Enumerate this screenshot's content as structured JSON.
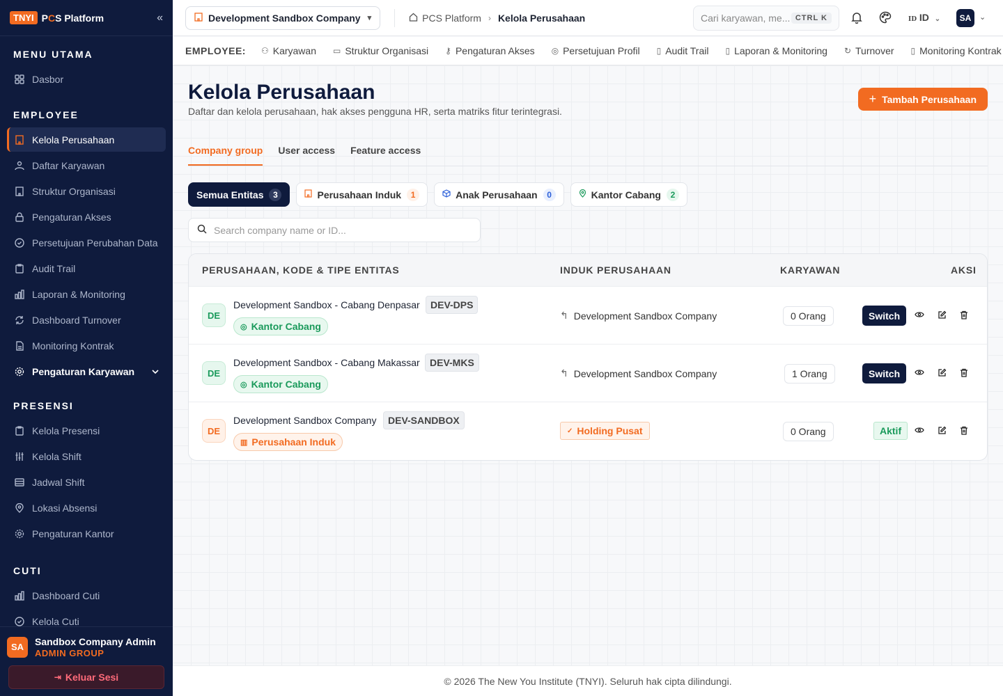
{
  "brand": {
    "badge": "TNYI",
    "name_prefix": "P",
    "name_accent": "C",
    "name_suffix": "S Platform"
  },
  "sidebar": {
    "sections": [
      {
        "title": "MENU UTAMA",
        "items": [
          {
            "label": "Dasbor",
            "icon": "grid-icon"
          }
        ]
      },
      {
        "title": "EMPLOYEE",
        "items": [
          {
            "label": "Kelola Perusahaan",
            "icon": "building-icon",
            "active": true
          },
          {
            "label": "Daftar Karyawan",
            "icon": "users-icon"
          },
          {
            "label": "Struktur Organisasi",
            "icon": "building-icon"
          },
          {
            "label": "Pengaturan Akses",
            "icon": "lock-icon"
          },
          {
            "label": "Persetujuan Perubahan Data",
            "icon": "check-circle-icon"
          },
          {
            "label": "Audit Trail",
            "icon": "clipboard-icon"
          },
          {
            "label": "Laporan & Monitoring",
            "icon": "chart-icon"
          },
          {
            "label": "Dashboard Turnover",
            "icon": "refresh-icon"
          },
          {
            "label": "Monitoring Kontrak",
            "icon": "file-icon"
          },
          {
            "label": "Pengaturan Karyawan",
            "icon": "gear-icon"
          }
        ]
      },
      {
        "title": "PRESENSI",
        "items": [
          {
            "label": "Kelola Presensi",
            "icon": "clipboard-icon"
          },
          {
            "label": "Kelola Shift",
            "icon": "sliders-icon"
          },
          {
            "label": "Jadwal Shift",
            "icon": "table-icon"
          },
          {
            "label": "Lokasi Absensi",
            "icon": "pin-icon"
          },
          {
            "label": "Pengaturan Kantor",
            "icon": "gear-icon"
          }
        ]
      },
      {
        "title": "CUTI",
        "items": [
          {
            "label": "Dashboard Cuti",
            "icon": "chart-icon"
          },
          {
            "label": "Kelola Cuti",
            "icon": "check-circle-icon"
          }
        ]
      }
    ],
    "user": {
      "initials": "SA",
      "name": "Sandbox Company Admin",
      "role": "ADMIN GROUP"
    },
    "logout": "Keluar Sesi"
  },
  "topbar": {
    "company": "Development Sandbox Company",
    "breadcrumb": [
      "PCS Platform",
      "Kelola Perusahaan"
    ],
    "search_placeholder": "Cari karyawan, me...",
    "shortcut": "CTRL K",
    "lang_small": "ID",
    "lang": "ID",
    "avatar": "SA"
  },
  "subnav": {
    "label": "EMPLOYEE:",
    "items": [
      "Karyawan",
      "Struktur Organisasi",
      "Pengaturan Akses",
      "Persetujuan Profil",
      "Audit Trail",
      "Laporan & Monitoring",
      "Turnover",
      "Monitoring Kontrak"
    ]
  },
  "page": {
    "title": "Kelola Perusahaan",
    "subtitle": "Daftar dan kelola perusahaan, hak akses pengguna HR, serta matriks fitur terintegrasi.",
    "add_button": "Tambah Perusahaan",
    "tabs": [
      "Company group",
      "User access",
      "Feature access"
    ],
    "filters": [
      {
        "label": "Semua Entitas",
        "count": "3"
      },
      {
        "label": "Perusahaan Induk",
        "count": "1"
      },
      {
        "label": "Anak Perusahaan",
        "count": "0"
      },
      {
        "label": "Kantor Cabang",
        "count": "2"
      }
    ],
    "search_placeholder": "Search company name or ID..."
  },
  "table": {
    "headers": [
      "PERUSAHAAN, KODE & TIPE ENTITAS",
      "INDUK PERUSAHAAN",
      "KARYAWAN",
      "AKSI"
    ],
    "rows": [
      {
        "initials": "DE",
        "name": "Development Sandbox - Cabang Denpasar",
        "code": "DEV-DPS",
        "type": "Kantor Cabang",
        "parent": "Development Sandbox Company",
        "employees": "0 Orang",
        "action": "Switch"
      },
      {
        "initials": "DE",
        "name": "Development Sandbox - Cabang Makassar",
        "code": "DEV-MKS",
        "type": "Kantor Cabang",
        "parent": "Development Sandbox Company",
        "employees": "1 Orang",
        "action": "Switch"
      },
      {
        "initials": "DE",
        "name": "Development Sandbox Company",
        "code": "DEV-SANDBOX",
        "type": "Perusahaan Induk",
        "parent": "Holding Pusat",
        "employees": "0 Orang",
        "action": "Aktif"
      }
    ]
  },
  "footer": "© 2026 The New You Institute (TNYI). Seluruh hak cipta dilindungi.",
  "colors": {
    "accent": "#f26b21",
    "navy": "#0f1b3d",
    "green": "#1a9a5b"
  }
}
